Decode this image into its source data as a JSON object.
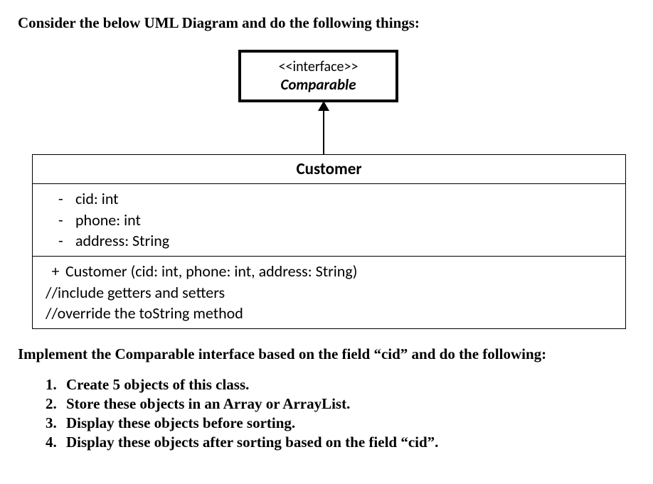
{
  "heading": "Consider the below UML Diagram and do the following things:",
  "interface": {
    "stereotype": "<<interface>>",
    "name": "Comparable"
  },
  "class": {
    "name": "Customer",
    "attributes": [
      {
        "vis": "-",
        "text": "cid: int"
      },
      {
        "vis": "-",
        "text": "phone: int"
      },
      {
        "vis": "-",
        "text": "address: String"
      }
    ],
    "operations": {
      "constructor": {
        "vis": "+",
        "text": "Customer (cid: int, phone: int, address: String)"
      },
      "comment1": "//include getters and setters",
      "comment2": "//override the toString method"
    }
  },
  "implement_text": "Implement the Comparable interface based on the field “cid” and do the following:",
  "tasks": [
    "Create 5 objects of this class.",
    "Store these objects in an Array or ArrayList.",
    "Display these objects before sorting.",
    "Display these objects after sorting based on the field “cid”."
  ]
}
